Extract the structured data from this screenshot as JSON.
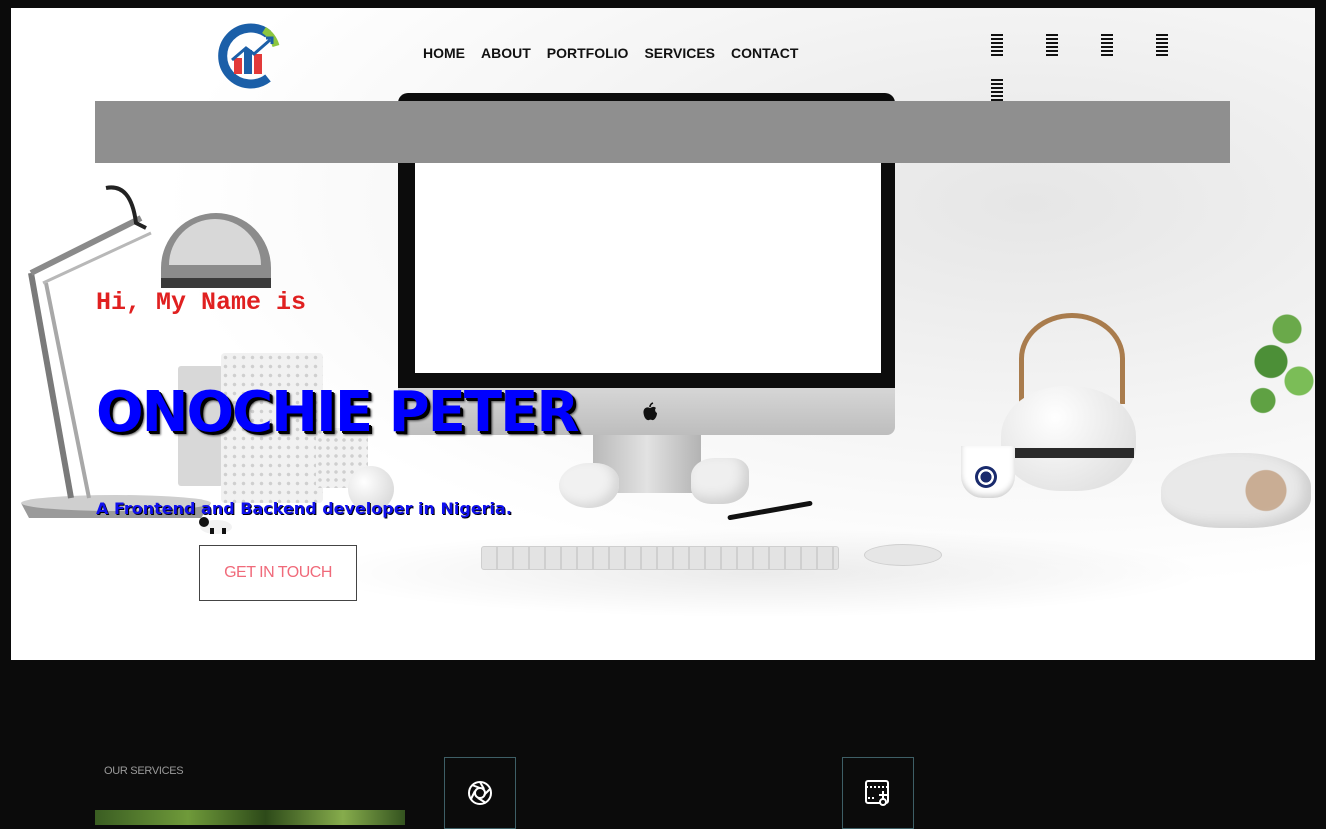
{
  "nav": {
    "items": [
      "HOME",
      "ABOUT",
      "PORTFOLIO",
      "SERVICES",
      "CONTACT"
    ]
  },
  "menu_icons": [
    "hamburger-icon",
    "hamburger-icon",
    "hamburger-icon",
    "hamburger-icon",
    "hamburger-icon"
  ],
  "hero": {
    "greeting": "Hi, My Name is",
    "name": "ONOCHIE PETER",
    "tagline": "A Frontend and Backend developer in Nigeria.",
    "cta_label": "GET IN TOUCH"
  },
  "services": {
    "label": "OUR SERVICES",
    "icons": [
      "camera-aperture-icon",
      "crop-edit-icon"
    ]
  },
  "colors": {
    "greeting": "#e02020",
    "name": "#0000ff",
    "cta_text": "#f06a7a",
    "background_dark": "#0b0b0b",
    "gray_bar": "#8f8f8f"
  }
}
